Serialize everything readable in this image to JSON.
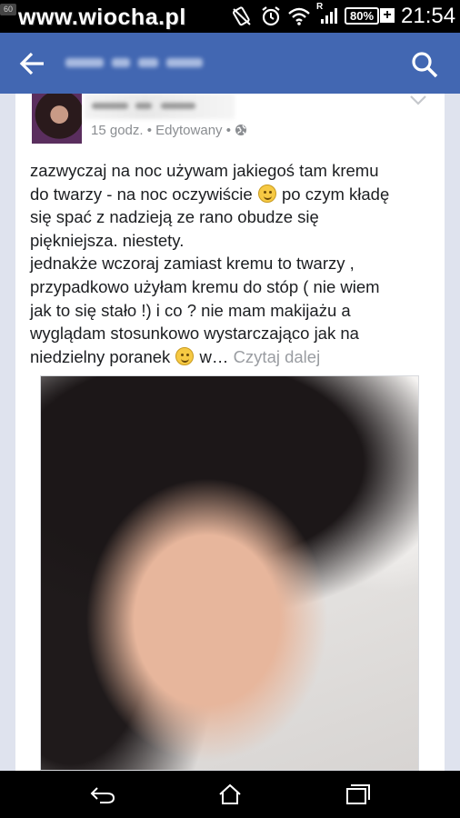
{
  "status_bar": {
    "watermark": "www.wiocha.pl",
    "watermark_badge": "60",
    "battery_percent": "80%",
    "battery_plus": "+",
    "time": "21:54",
    "signal_letter": "R",
    "icons": [
      "no-sound-icon",
      "alarm-icon",
      "wifi-icon",
      "signal-icon",
      "battery-icon"
    ]
  },
  "app_bar": {
    "title_blurred": true,
    "color": "#4267b2",
    "icons": [
      "back-arrow-icon",
      "search-icon"
    ]
  },
  "post": {
    "author_blurred": true,
    "time": "15 godz.",
    "separator": "•",
    "edited": "Edytowany",
    "privacy_icon": "globe-icon",
    "text_part1": "zazwyczaj na noc używam jakiegoś tam kremu\ndo twarzy - na noc oczywiście ",
    "text_part2": " po czym kładę\nsię spać z nadzieją ze rano obudze się\npiękniejsza. niestety.\njednakże wczoraj zamiast kremu to twarzy ,\nprzypadkowo użyłam kremu do stóp ( nie wiem\njak to się stało !) i co ? nie mam makijażu a\nwyglądam stosunkowo wystarczająco jak na\nniedzielny poranek ",
    "text_part3": " w…",
    "read_more": "Czytaj dalej",
    "emoji_icons": [
      "winking-emoji-icon",
      "smiling-emoji-icon"
    ]
  },
  "nav_bar": {
    "icons": [
      "back-nav-icon",
      "home-nav-icon",
      "recent-apps-icon"
    ]
  }
}
